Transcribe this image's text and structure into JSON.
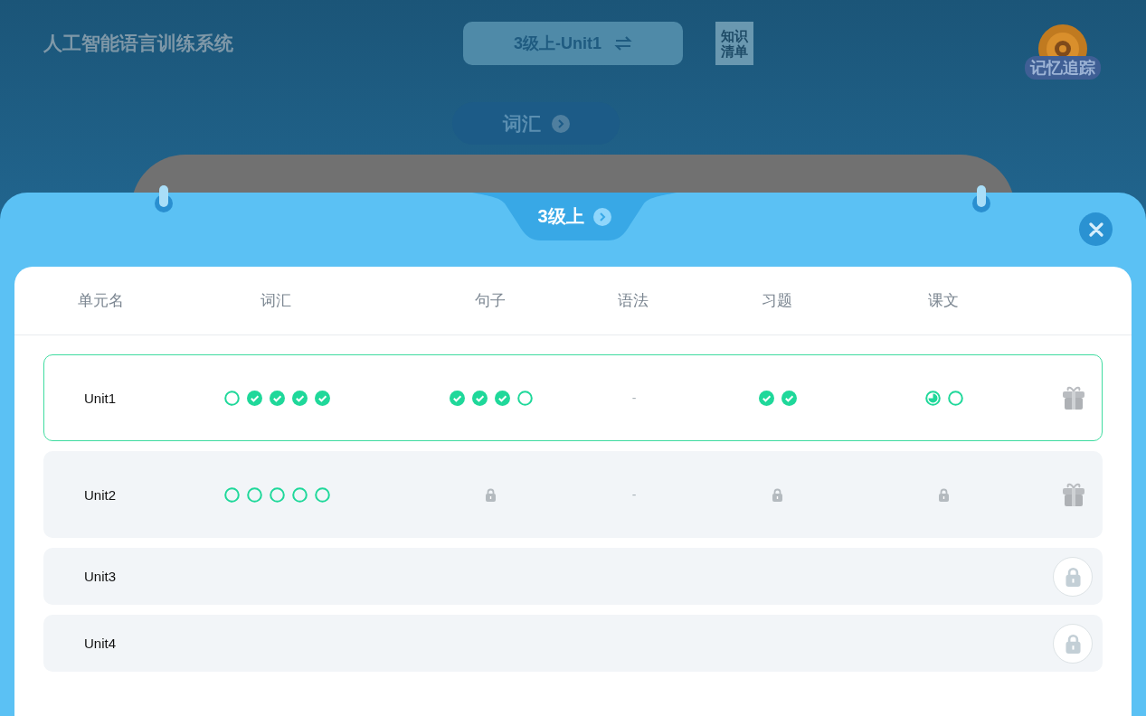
{
  "header": {
    "title": "人工智能语言训练系统",
    "unit_selector": {
      "label": "3级上-Unit1"
    },
    "knowledge_list": {
      "lines": [
        "知识",
        "清单"
      ]
    },
    "memory_tracking": {
      "label": "记忆追踪"
    }
  },
  "category_button": {
    "label": "词汇"
  },
  "modal": {
    "level_tab": {
      "label": "3级上"
    },
    "table": {
      "columns": [
        "单元名",
        "词汇",
        "句子",
        "语法",
        "习题",
        "课文"
      ],
      "rows": [
        {
          "unit": "Unit1",
          "selected": true,
          "locked": false,
          "cells": [
            {
              "kind": "progress",
              "items": [
                {
                  "checked": false,
                  "partial": false
                },
                {
                  "checked": true,
                  "partial": false
                },
                {
                  "checked": true,
                  "partial": false
                },
                {
                  "checked": true,
                  "partial": false
                },
                {
                  "checked": true,
                  "partial": false
                }
              ]
            },
            {
              "kind": "progress",
              "items": [
                {
                  "checked": true,
                  "partial": false
                },
                {
                  "checked": true,
                  "partial": false
                },
                {
                  "checked": true,
                  "partial": false
                },
                {
                  "checked": false,
                  "partial": false
                }
              ]
            },
            {
              "kind": "dash",
              "text": "-"
            },
            {
              "kind": "progress",
              "items": [
                {
                  "checked": true,
                  "partial": false
                },
                {
                  "checked": true,
                  "partial": false
                }
              ]
            },
            {
              "kind": "progress",
              "items": [
                {
                  "checked": false,
                  "partial": true
                },
                {
                  "checked": false,
                  "partial": false
                }
              ]
            }
          ]
        },
        {
          "unit": "Unit2",
          "selected": false,
          "locked": false,
          "cells": [
            {
              "kind": "progress",
              "items": [
                {
                  "checked": false,
                  "partial": false
                },
                {
                  "checked": false,
                  "partial": false
                },
                {
                  "checked": false,
                  "partial": false
                },
                {
                  "checked": false,
                  "partial": false
                },
                {
                  "checked": false,
                  "partial": false
                }
              ]
            },
            {
              "kind": "lock"
            },
            {
              "kind": "dash",
              "text": "-"
            },
            {
              "kind": "lock"
            },
            {
              "kind": "lock"
            }
          ]
        },
        {
          "unit": "Unit3",
          "selected": false,
          "locked": true
        },
        {
          "unit": "Unit4",
          "selected": false,
          "locked": true
        }
      ]
    }
  }
}
